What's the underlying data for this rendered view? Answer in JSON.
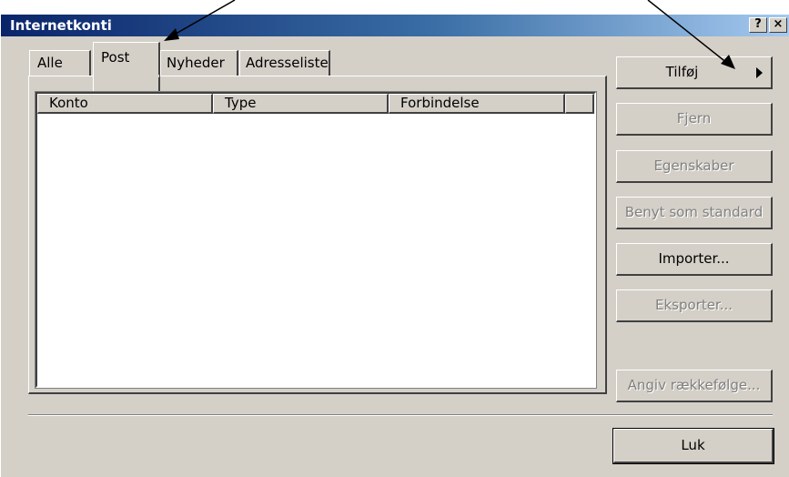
{
  "window": {
    "title": "Internetkonti",
    "help_label": "?",
    "close_label": "×"
  },
  "tabs": [
    {
      "label": "Alle"
    },
    {
      "label": "Post"
    },
    {
      "label": "Nyheder"
    },
    {
      "label": "Adresseliste"
    }
  ],
  "active_tab": "Post",
  "list": {
    "columns": [
      "Konto",
      "Type",
      "Forbindelse"
    ],
    "rows": []
  },
  "buttons": {
    "tilfoej": "Tilføj",
    "fjern": "Fjern",
    "egenskaber": "Egenskaber",
    "benyt_som_standard": "Benyt som standard",
    "importer": "Importer...",
    "eksporter": "Eksporter...",
    "angiv_raekkefoelge": "Angiv rækkefølge...",
    "luk": "Luk"
  },
  "colors": {
    "dialog_face": "#d4d0c8",
    "titlebar_start": "#0a246a",
    "titlebar_end": "#a6caf0"
  }
}
